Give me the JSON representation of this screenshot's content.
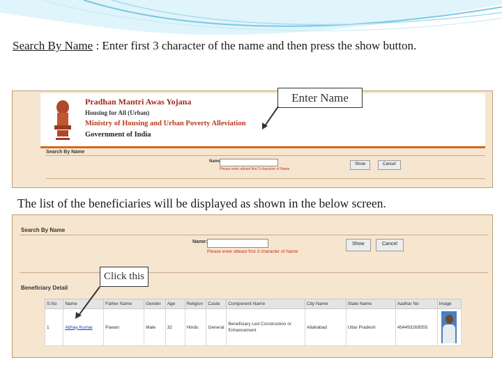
{
  "intro": {
    "link": "Search By Name",
    "text": " : Enter  first 3 character of the name and then press the show button."
  },
  "screen1": {
    "org_line1": "Pradhan Mantri Awas Yojana",
    "org_line2": "Housing for All (Urban)",
    "org_line3": "Ministry of Housing and Urban Poverty Alleviation",
    "org_line4": "Government of India",
    "search_label": "Search By Name",
    "name_label": "Name:",
    "hint": "Please enter atleast first 3 character of Name",
    "show": "Show",
    "cancel": "Cancel"
  },
  "callout_enter": "Enter Name",
  "mid_text": "The list of the beneficiaries will be displayed as shown in the below screen.",
  "screen2": {
    "search_label": "Search By Name",
    "name_label": "Name:",
    "hint": "Please enter atleast first 3 character of Name",
    "show": "Show",
    "cancel": "Cancel",
    "ben_label": "Beneficiary Detail",
    "headers": [
      "S.No",
      "Name",
      "Father Name",
      "Gender",
      "Age",
      "Religion",
      "Caste",
      "Component Name",
      "City Name",
      "State Name",
      "Aadhar No",
      "Image"
    ],
    "row": [
      "1",
      "Abhay Kumar",
      "Pawan",
      "Male",
      "32",
      "Hindu",
      "General",
      "Beneficiary Led Construction or Enhancement",
      "Allahabad",
      "Uttar Pradesh",
      "454493269555",
      ""
    ]
  },
  "callout_click": "Click this",
  "colors": {
    "panel": "#f6e6cf",
    "accent": "#d9661e",
    "hint": "#cc2b1d",
    "link": "#1a3ea8"
  }
}
